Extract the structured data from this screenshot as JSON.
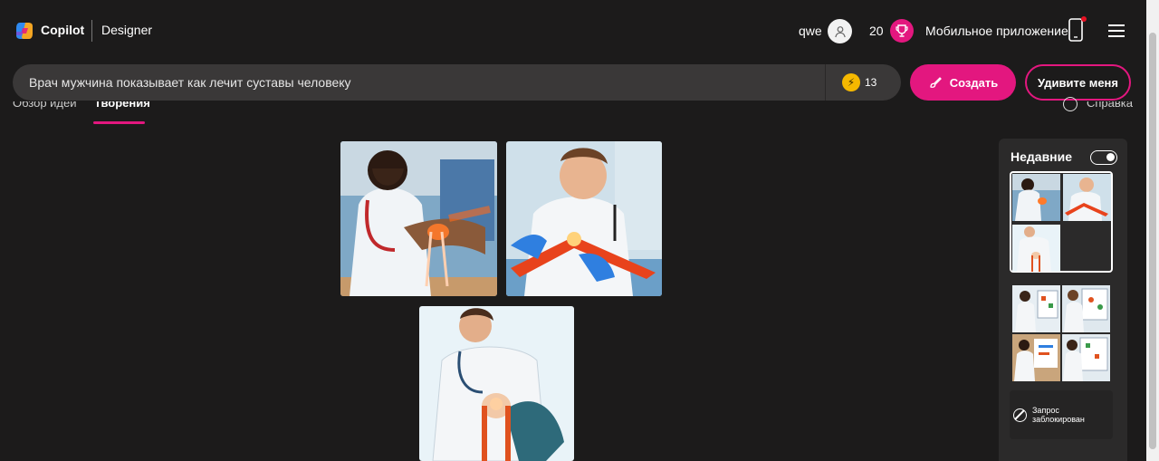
{
  "header": {
    "brand": "Copilot",
    "product": "Designer",
    "username": "qwe",
    "rewards_count": "20",
    "mobile_app": "Мобильное приложение"
  },
  "search": {
    "value": "Врач мужчина показывает как лечит суставы человеку",
    "boost_count": "13"
  },
  "actions": {
    "create": "Создать",
    "surprise": "Удивите меня"
  },
  "tabs": [
    {
      "label": "Обзор идей"
    },
    {
      "label": "Творения"
    }
  ],
  "help": "Справка",
  "recent": {
    "title": "Недавние",
    "blocked": "Запрос заблокирован"
  },
  "colors": {
    "accent": "#e3177f",
    "background": "#1c1b1b"
  }
}
